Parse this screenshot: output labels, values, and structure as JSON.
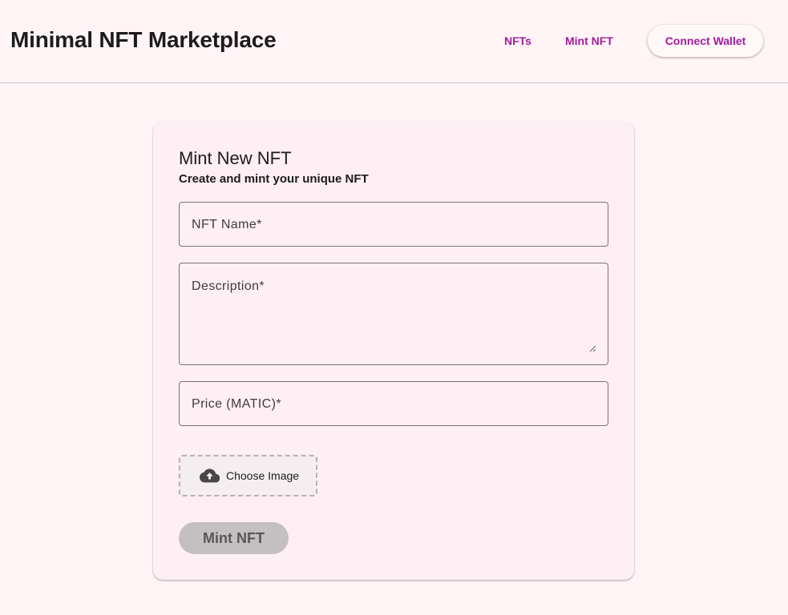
{
  "app": {
    "title": "Minimal NFT Marketplace"
  },
  "nav": {
    "items": [
      {
        "label": "NFTs"
      },
      {
        "label": "Mint NFT"
      }
    ],
    "connect_wallet_label": "Connect Wallet"
  },
  "form": {
    "title": "Mint New NFT",
    "subtitle": "Create and mint your unique NFT",
    "fields": {
      "name": {
        "label": "NFT Name*",
        "value": ""
      },
      "description": {
        "label": "Description*",
        "value": ""
      },
      "price": {
        "label": "Price (MATIC)*",
        "value": ""
      }
    },
    "upload": {
      "label": "Choose Image",
      "icon": "cloud-upload-icon"
    },
    "submit_label": "Mint NFT",
    "submit_disabled": true
  },
  "colors": {
    "background": "#fff5f6",
    "card": "#fdeff3",
    "accent": "#a31c9c",
    "disabled_button": "#c4c0c2",
    "field_border": "#7a7378"
  }
}
